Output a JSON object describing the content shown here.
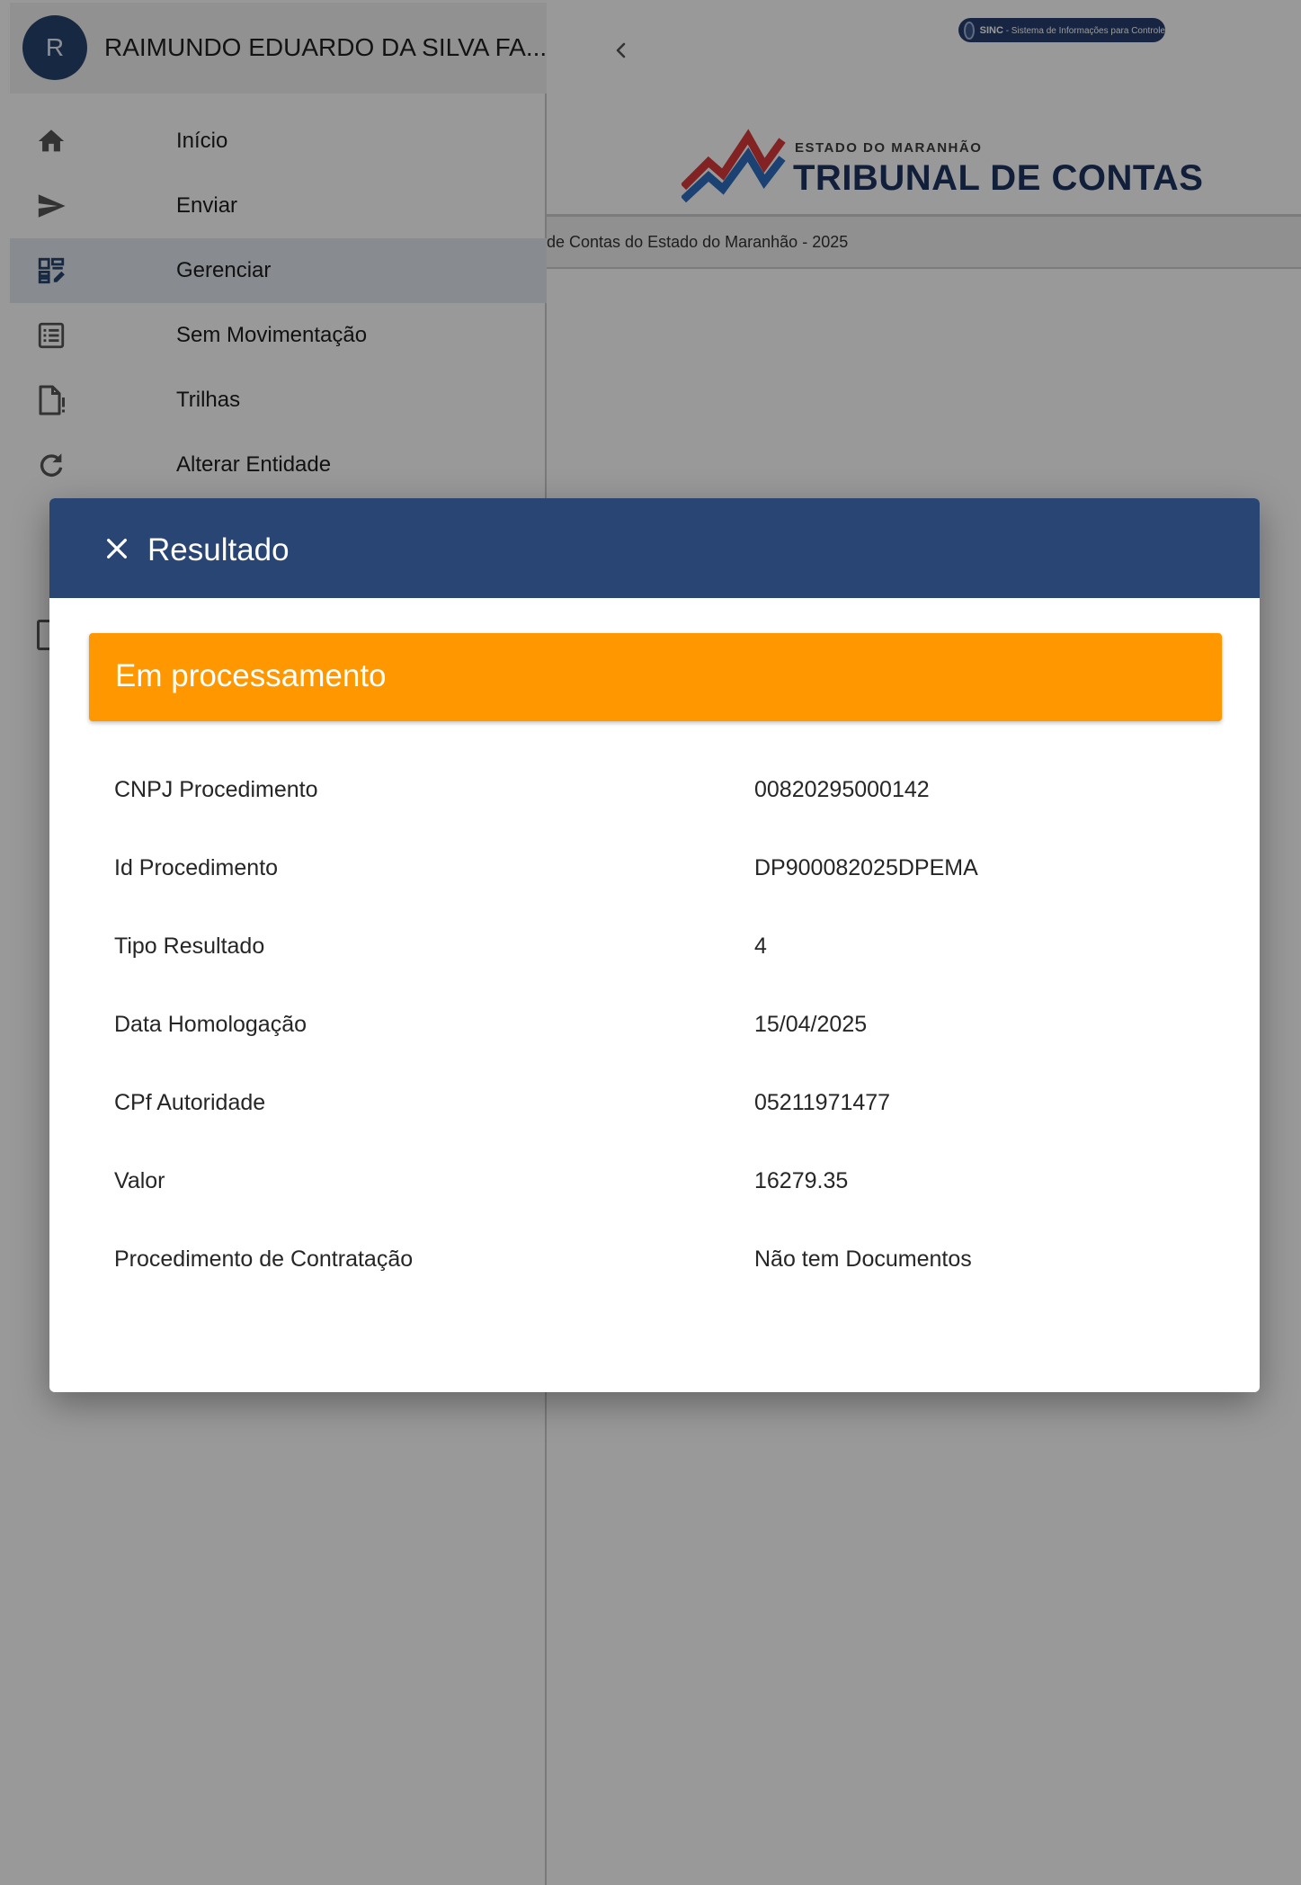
{
  "app": {
    "user_initial": "R",
    "user_name": "RAIMUNDO EDUARDO DA SILVA FA...",
    "sinc_badge": "SINC",
    "sinc_badge_caption": "- Sistema de Informações para Controle",
    "logo_small": "ESTADO DO MARANHÃO",
    "logo_big": "TRIBUNAL DE CONTAS",
    "footer_text": "de Contas do Estado do Maranhão - 2025"
  },
  "sidebar": {
    "items": [
      {
        "label": "Início",
        "icon": "home-icon"
      },
      {
        "label": "Enviar",
        "icon": "send-icon"
      },
      {
        "label": "Gerenciar",
        "icon": "dashboard-edit-icon",
        "active": true
      },
      {
        "label": "Sem Movimentação",
        "icon": "list-icon"
      },
      {
        "label": "Trilhas",
        "icon": "file-alert-icon"
      },
      {
        "label": "Alterar Entidade",
        "icon": "refresh-icon"
      }
    ]
  },
  "dialog": {
    "title": "Resultado",
    "status": "Em processamento",
    "rows": [
      {
        "label": "CNPJ Procedimento",
        "value": "00820295000142"
      },
      {
        "label": "Id Procedimento",
        "value": "DP900082025DPEMA"
      },
      {
        "label": "Tipo Resultado",
        "value": "4"
      },
      {
        "label": "Data Homologação",
        "value": "15/04/2025"
      },
      {
        "label": "CPf Autoridade",
        "value": "05211971477"
      },
      {
        "label": "Valor",
        "value": "16279.35"
      },
      {
        "label": "Procedimento de Contratação",
        "value": "Não tem Documentos"
      }
    ]
  },
  "colors": {
    "header_blue": "#284573",
    "status_orange": "#ff9800",
    "active_nav": "#e3e8f0"
  }
}
